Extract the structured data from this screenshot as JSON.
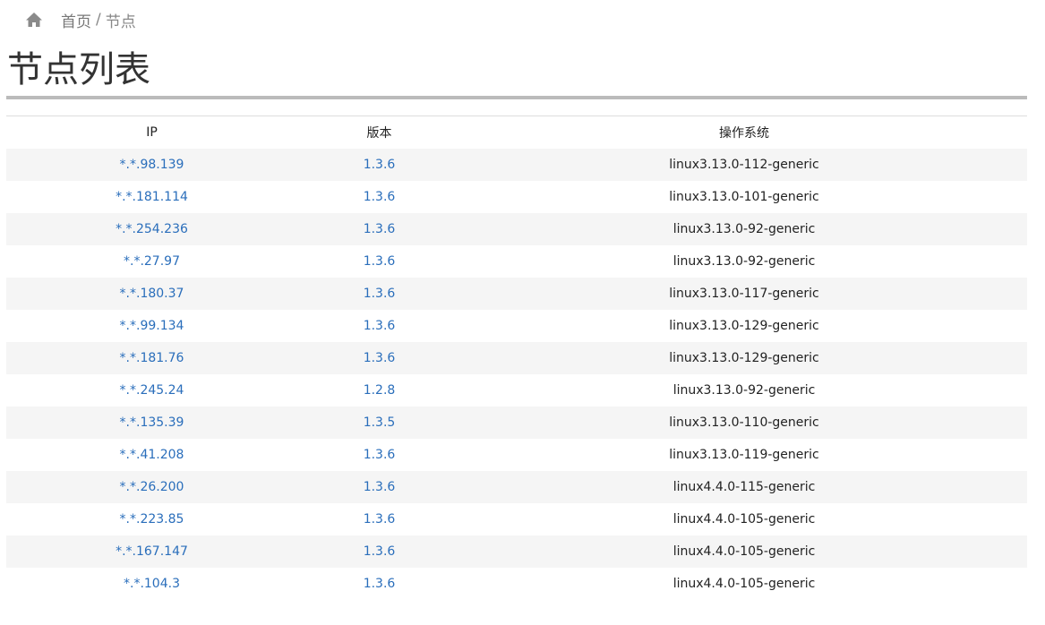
{
  "breadcrumb": {
    "home_icon": "home-icon",
    "home_label": "首页",
    "separator": "/",
    "current_label": "节点"
  },
  "page": {
    "title": "节点列表"
  },
  "colors": {
    "link": "#2a6ebb",
    "stripe": "#f5f5f5",
    "rule": "#bbbbbb"
  },
  "table": {
    "headers": {
      "ip": "IP",
      "version": "版本",
      "os": "操作系统"
    },
    "rows": [
      {
        "ip": "*.*.98.139",
        "version": "1.3.6",
        "os": "linux3.13.0-112-generic"
      },
      {
        "ip": "*.*.181.114",
        "version": "1.3.6",
        "os": "linux3.13.0-101-generic"
      },
      {
        "ip": "*.*.254.236",
        "version": "1.3.6",
        "os": "linux3.13.0-92-generic"
      },
      {
        "ip": "*.*.27.97",
        "version": "1.3.6",
        "os": "linux3.13.0-92-generic"
      },
      {
        "ip": "*.*.180.37",
        "version": "1.3.6",
        "os": "linux3.13.0-117-generic"
      },
      {
        "ip": "*.*.99.134",
        "version": "1.3.6",
        "os": "linux3.13.0-129-generic"
      },
      {
        "ip": "*.*.181.76",
        "version": "1.3.6",
        "os": "linux3.13.0-129-generic"
      },
      {
        "ip": "*.*.245.24",
        "version": "1.2.8",
        "os": "linux3.13.0-92-generic"
      },
      {
        "ip": "*.*.135.39",
        "version": "1.3.5",
        "os": "linux3.13.0-110-generic"
      },
      {
        "ip": "*.*.41.208",
        "version": "1.3.6",
        "os": "linux3.13.0-119-generic"
      },
      {
        "ip": "*.*.26.200",
        "version": "1.3.6",
        "os": "linux4.4.0-115-generic"
      },
      {
        "ip": "*.*.223.85",
        "version": "1.3.6",
        "os": "linux4.4.0-105-generic"
      },
      {
        "ip": "*.*.167.147",
        "version": "1.3.6",
        "os": "linux4.4.0-105-generic"
      },
      {
        "ip": "*.*.104.3",
        "version": "1.3.6",
        "os": "linux4.4.0-105-generic"
      }
    ]
  }
}
